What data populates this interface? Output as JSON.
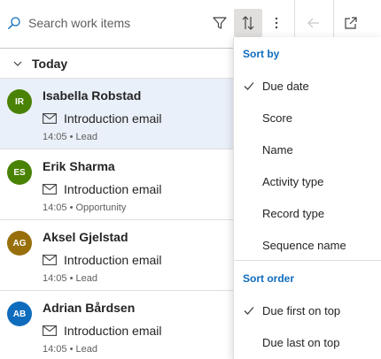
{
  "toolbar": {
    "search_placeholder": "Search work items",
    "filter_icon": "filter-icon",
    "sort_icon": "sort-icon",
    "more_icon": "more-vertical-icon",
    "back_icon": "arrow-left-icon",
    "popout_icon": "popout-icon"
  },
  "list": {
    "group_title": "Today",
    "items": [
      {
        "initials": "IR",
        "name": "Isabella Robstad",
        "activity": "Introduction email",
        "meta": "14:05 • Lead",
        "avatar_color": "#498205",
        "selected": true
      },
      {
        "initials": "ES",
        "name": "Erik Sharma",
        "activity": "Introduction email",
        "meta": "14:05 • Opportunity",
        "avatar_color": "#498205",
        "selected": false
      },
      {
        "initials": "AG",
        "name": "Aksel Gjelstad",
        "activity": "Introduction email",
        "meta": "14:05 • Lead",
        "avatar_color": "#986f0b",
        "selected": false
      },
      {
        "initials": "AB",
        "name": "Adrian Bårdsen",
        "activity": "Introduction email",
        "meta": "14:05 • Lead",
        "avatar_color": "#0f6cbd",
        "selected": false
      }
    ]
  },
  "sort_menu": {
    "sort_by_heading": "Sort by",
    "sort_by_options": [
      {
        "label": "Due date",
        "checked": true
      },
      {
        "label": "Score",
        "checked": false
      },
      {
        "label": "Name",
        "checked": false
      },
      {
        "label": "Activity type",
        "checked": false
      },
      {
        "label": "Record type",
        "checked": false
      },
      {
        "label": "Sequence name",
        "checked": false
      }
    ],
    "sort_order_heading": "Sort order",
    "sort_order_options": [
      {
        "label": "Due first on top",
        "checked": true
      },
      {
        "label": "Due last on top",
        "checked": false
      }
    ]
  },
  "colors": {
    "accent": "#0f6cbd",
    "selected_row": "#eaf0f9"
  }
}
